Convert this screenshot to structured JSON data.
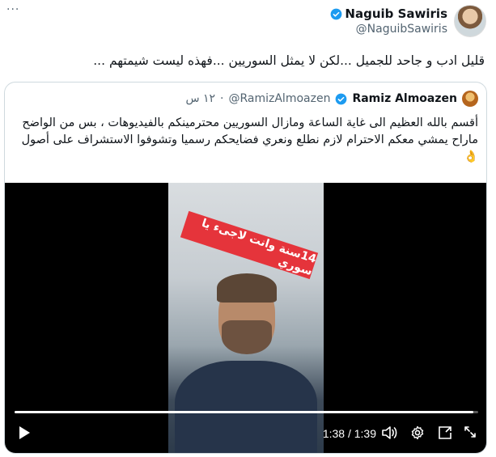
{
  "tweet": {
    "more_label": "···",
    "author_name": "Naguib Sawiris",
    "author_handle": "@NaguibSawiris",
    "text": "قليل ادب و جاحد للجميل ...لكن لا يمثل السوريين ...فهذه ليست شيمتهم ..."
  },
  "quote": {
    "author_name": "Ramiz Almoazen",
    "author_handle": "@RamizAlmoazen",
    "time": "١٢ س",
    "separator": "·",
    "text": "أقسم بالله العظيم الى غاية الساعة ومازال السوريين محترمينكم بالفيديوهات ، بس من الواضح ماراح يمشي معكم الاحترام لازم نطلع ونعري  فضايحكم  رسميا وتشوفوا الاستشراف على أصول 👌"
  },
  "video": {
    "overlay_text": "14سنة وانت لاجىء يا سوري",
    "time_display": "1:38 / 1:39",
    "progress": 0.99,
    "icons": [
      "play-icon",
      "volume-icon",
      "settings-icon",
      "dock-icon",
      "fullscreen-icon"
    ]
  },
  "colors": {
    "verified_blue": "#1d9bf0",
    "text_secondary": "#536471",
    "border": "#cfd9de",
    "banner_red": "#e5343b"
  }
}
